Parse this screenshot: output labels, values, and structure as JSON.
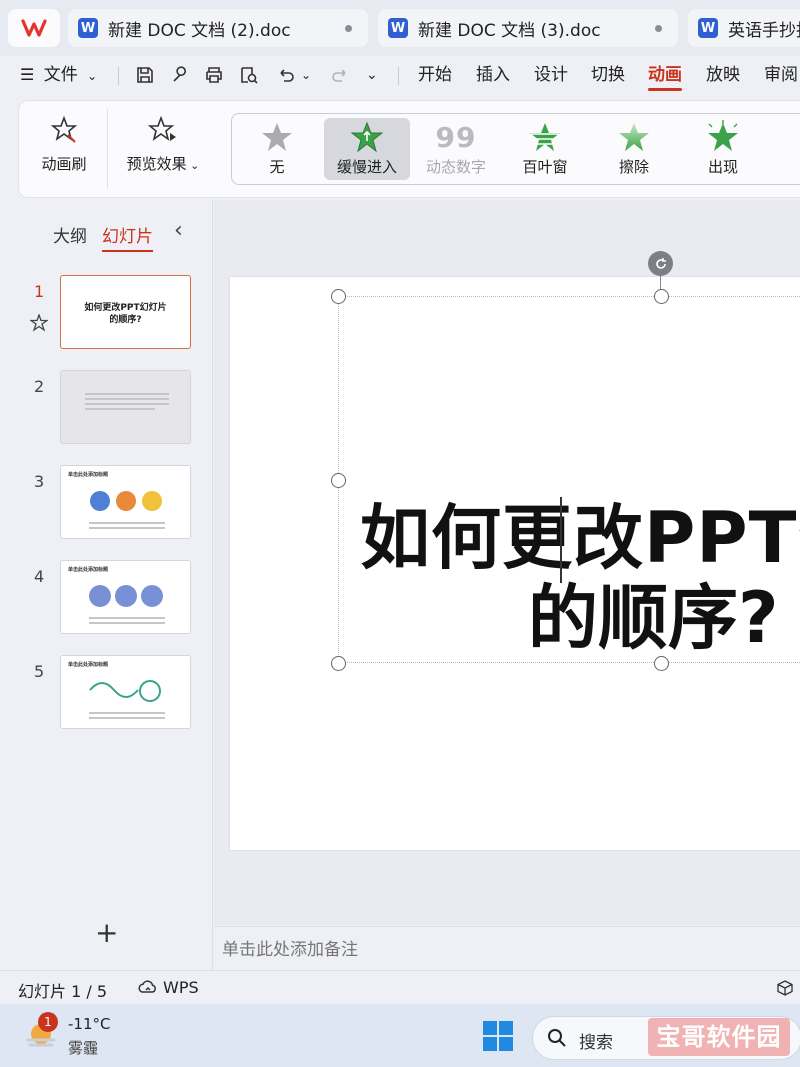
{
  "tabs": [
    {
      "title": "新建 DOC 文档 (2).doc"
    },
    {
      "title": "新建 DOC 文档 (3).doc"
    },
    {
      "title": "英语手抄报"
    }
  ],
  "menu": {
    "file": "文件",
    "items": [
      "开始",
      "插入",
      "设计",
      "切换",
      "动画",
      "放映",
      "审阅"
    ],
    "active": "动画"
  },
  "ribbon": {
    "painter": "动画刷",
    "preview": "预览效果",
    "effects": [
      "无",
      "缓慢进入",
      "动态数字",
      "百叶窗",
      "擦除",
      "出现"
    ],
    "selected_effect": "缓慢进入"
  },
  "panel": {
    "tab_outline": "大纲",
    "tab_slides": "幻灯片",
    "add": "+",
    "thumbs": [
      {
        "num": "1",
        "title_line1": "如何更改PPT幻灯片",
        "title_line2": "的顺序?"
      },
      {
        "num": "2"
      },
      {
        "num": "3",
        "head": "单击此处添加标题"
      },
      {
        "num": "4",
        "head": "单击此处添加标题"
      },
      {
        "num": "5",
        "head": "单击此处添加标题"
      }
    ]
  },
  "slide": {
    "title_line1": "如何更改PPT幻",
    "title_line2": "的顺序?"
  },
  "notes": {
    "placeholder": "单击此处添加备注"
  },
  "status": {
    "slide_counter": "幻灯片 1 / 5",
    "app": "WPS"
  },
  "taskbar": {
    "weather_badge": "1",
    "temperature": "-11°C",
    "condition": "雾霾",
    "search_text": "搜索",
    "watermark": "宝哥软件园"
  },
  "colors": {
    "accent": "#c8341c",
    "star_green": "#3aa34a",
    "star_grey": "#a9abb1"
  }
}
